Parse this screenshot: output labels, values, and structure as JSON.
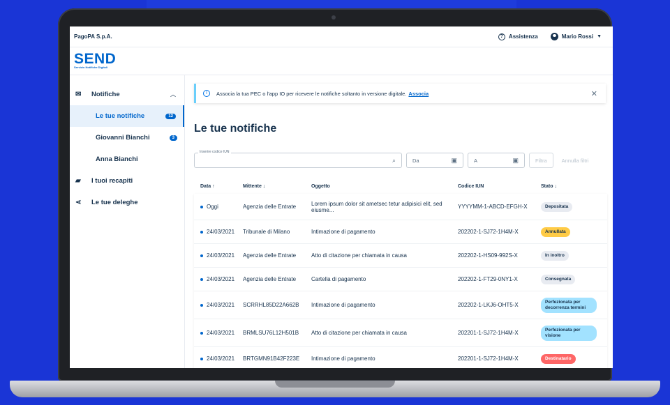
{
  "header": {
    "company": "PagoPA S.p.A.",
    "assistance_label": "Assistenza",
    "user_name": "Mario Rossi"
  },
  "brand": {
    "logo_text": "SEND",
    "logo_subtitle": "Servizio Notifiche Digitali"
  },
  "sidebar": {
    "section_notifiche": "Notifiche",
    "sub_items": [
      {
        "label": "Le tue notifiche",
        "count": "12"
      },
      {
        "label": "Giovanni Bianchi",
        "count": "3"
      },
      {
        "label": "Anna Bianchi",
        "count": ""
      }
    ],
    "recapiti": "I tuoi recapiti",
    "deleghe": "Le tue deleghe"
  },
  "alert": {
    "text": "Associa la tua PEC o l'app IO per ricevere le notifiche soltanto in versione digitale.",
    "link": "Associa"
  },
  "page": {
    "title": "Le tue notifiche"
  },
  "filters": {
    "iun_legend": "Inserire codice IUN",
    "from_placeholder": "Da",
    "to_placeholder": "A",
    "filter_button": "Filtra",
    "reset_button": "Annulla filtri"
  },
  "table": {
    "headers": {
      "date": "Data ↑",
      "sender": "Mittente ↓",
      "subject": "Oggetto",
      "iun": "Codice IUN",
      "status": "Stato ↓"
    },
    "rows": [
      {
        "date": "Oggi",
        "sender": "Agenzia delle Entrate",
        "subject": "Lorem ipsum dolor sit ametsec tetur adipisici elit, sed eiusme...",
        "iun": "YYYYMM-1-ABCD-EFGH-X",
        "status": "Depositata"
      },
      {
        "date": "24/03/2021",
        "sender": "Tribunale di Milano",
        "subject": "Intimazione di pagamento",
        "iun": "202202-1-SJ72-1H4M-X",
        "status": "Annullata"
      },
      {
        "date": "24/03/2021",
        "sender": "Agenzia delle Entrate",
        "subject": "Atto di citazione per chiamata in causa",
        "iun": "202202-1-HS09-992S-X",
        "status": "In inoltro"
      },
      {
        "date": "24/03/2021",
        "sender": "Agenzia delle Entrate",
        "subject": "Cartella di pagamento",
        "iun": "202202-1-FT29-0NY1-X",
        "status": "Consegnata"
      },
      {
        "date": "24/03/2021",
        "sender": "SCRRHL85D22A662B",
        "subject": "Intimazione di pagamento",
        "iun": "202202-1-LKJ6-OHT5-X",
        "status": "Perfezionata per decorrenza termini"
      },
      {
        "date": "24/03/2021",
        "sender": "BRMLSU76L12H501B",
        "subject": "Atto di citazione per chiamata in causa",
        "iun": "202201-1-SJ72-1H4M-X",
        "status": "Perfezionata per visione"
      },
      {
        "date": "24/03/2021",
        "sender": "BRTGMN91B42F223E",
        "subject": "Intimazione di pagamento",
        "iun": "202201-1-SJ72-1H4M-X",
        "status": "Destinatario"
      }
    ]
  },
  "colors": {
    "background": "#1a35d6",
    "primary": "#0066cc",
    "text": "#17324d",
    "chip_default": "#e8ebf1",
    "chip_warning": "#ffcb46",
    "chip_info": "#a2e2ff",
    "chip_error": "#fe6666"
  }
}
